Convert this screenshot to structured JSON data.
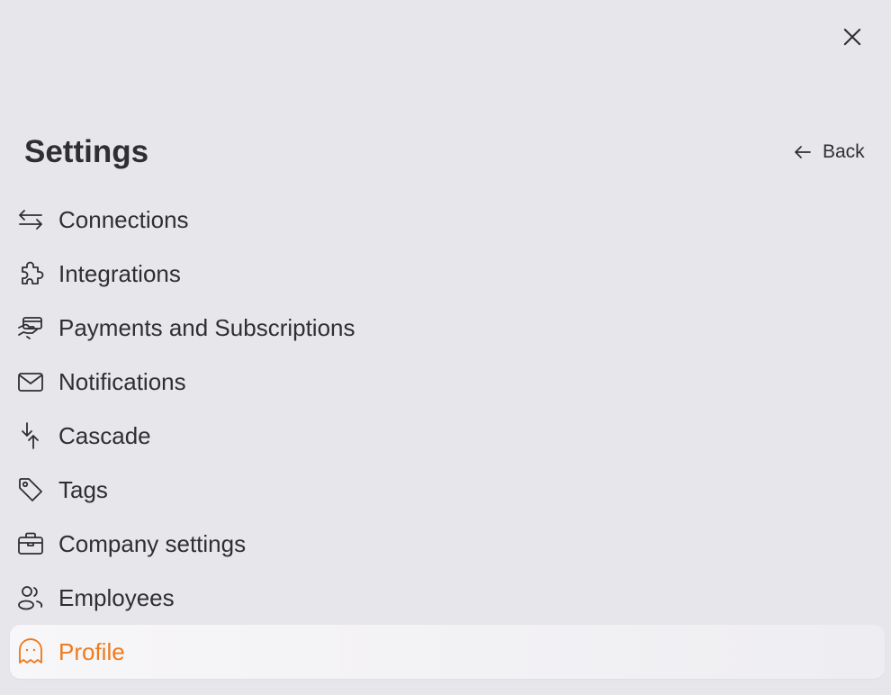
{
  "header": {
    "title": "Settings",
    "back_label": "Back",
    "close_icon": "close-icon",
    "back_icon": "arrow-left-icon"
  },
  "menu": {
    "items": [
      {
        "label": "Connections",
        "icon": "arrows-exchange-icon"
      },
      {
        "label": "Integrations",
        "icon": "puzzle-icon"
      },
      {
        "label": "Payments and Subscriptions",
        "icon": "payment-hand-icon"
      },
      {
        "label": "Notifications",
        "icon": "envelope-icon"
      },
      {
        "label": "Cascade",
        "icon": "cascade-arrows-icon"
      },
      {
        "label": "Tags",
        "icon": "tag-icon"
      },
      {
        "label": "Company settings",
        "icon": "briefcase-icon"
      },
      {
        "label": "Employees",
        "icon": "users-icon"
      },
      {
        "label": "Profile",
        "icon": "ghost-icon",
        "active": true
      }
    ]
  },
  "colors": {
    "background": "#e7e6eb",
    "text": "#2f2f33",
    "accent": "#f07a1e",
    "active_background": "#f4f3f6"
  }
}
